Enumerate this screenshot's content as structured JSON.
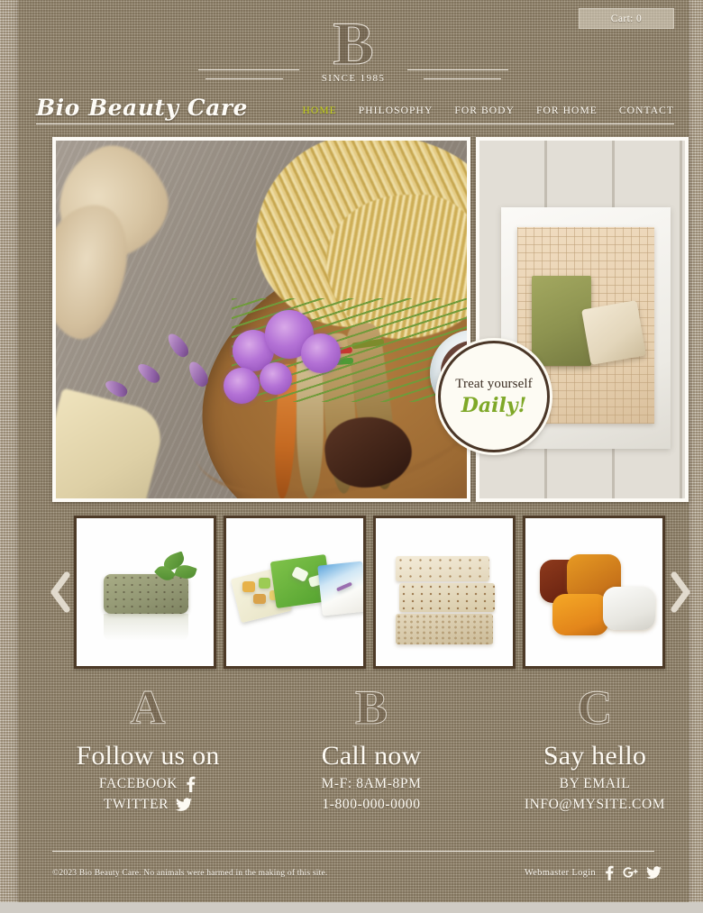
{
  "cart": {
    "label": "Cart: 0"
  },
  "crest": {
    "letter": "B",
    "since": "SINCE 1985"
  },
  "brand": {
    "name": "Bio Beauty Care"
  },
  "nav": {
    "items": [
      {
        "label": "HOME",
        "active": true
      },
      {
        "label": "PHILOSOPHY",
        "active": false
      },
      {
        "label": "FOR BODY",
        "active": false
      },
      {
        "label": "FOR HOME",
        "active": false
      },
      {
        "label": "CONTACT",
        "active": false
      }
    ]
  },
  "hero": {
    "left_image_alt": "Dried herbs, ginger root, purple chive blossoms and dried roots on a wooden plate with a bowl of rosebuds",
    "right_image_alt": "Green olive soap bar and cream soap bar on a waffle towel over white cloth on weathered wood planks"
  },
  "badge": {
    "line1": "Treat yourself",
    "line2": "Daily!"
  },
  "carousel": {
    "prev_icon": "chevron-left-icon",
    "next_icon": "chevron-right-icon",
    "thumbs": [
      {
        "alt": "Green herbal soap bar with fresh mint leaves"
      },
      {
        "alt": "Three colorful translucent glycerin soaps in green, yellow and blue"
      },
      {
        "alt": "Stack of three oatmeal exfoliating soap bars"
      },
      {
        "alt": "Four amber and clear glycerin soap bars"
      }
    ]
  },
  "columns": [
    {
      "letter": "A",
      "title": "Follow us on",
      "lines": [
        {
          "text": "FACEBOOK",
          "icon": "facebook-icon"
        },
        {
          "text": "TWITTER",
          "icon": "twitter-icon"
        }
      ]
    },
    {
      "letter": "B",
      "title": "Call now",
      "lines": [
        {
          "text": "M-F: 8AM-8PM",
          "icon": ""
        },
        {
          "text": "1-800-000-0000",
          "icon": ""
        }
      ]
    },
    {
      "letter": "C",
      "title": "Say hello",
      "lines": [
        {
          "text": "BY EMAIL",
          "icon": ""
        },
        {
          "text": "INFO@MYSITE.COM",
          "icon": ""
        }
      ]
    }
  ],
  "footer": {
    "copyright": "©2023 Bio Beauty Care. No animals were harmed in the making of this site.",
    "webmaster_login": "Webmaster Login",
    "social": [
      {
        "icon": "facebook-icon"
      },
      {
        "icon": "google-plus-icon"
      },
      {
        "icon": "twitter-icon"
      }
    ]
  },
  "colors": {
    "page_bg": "#b3a68f",
    "content_bg": "#96886f",
    "accent_green": "#c3d118",
    "badge_green": "#7fa828",
    "cream": "#fdfbf6",
    "frame_dark": "#4d3a27"
  }
}
